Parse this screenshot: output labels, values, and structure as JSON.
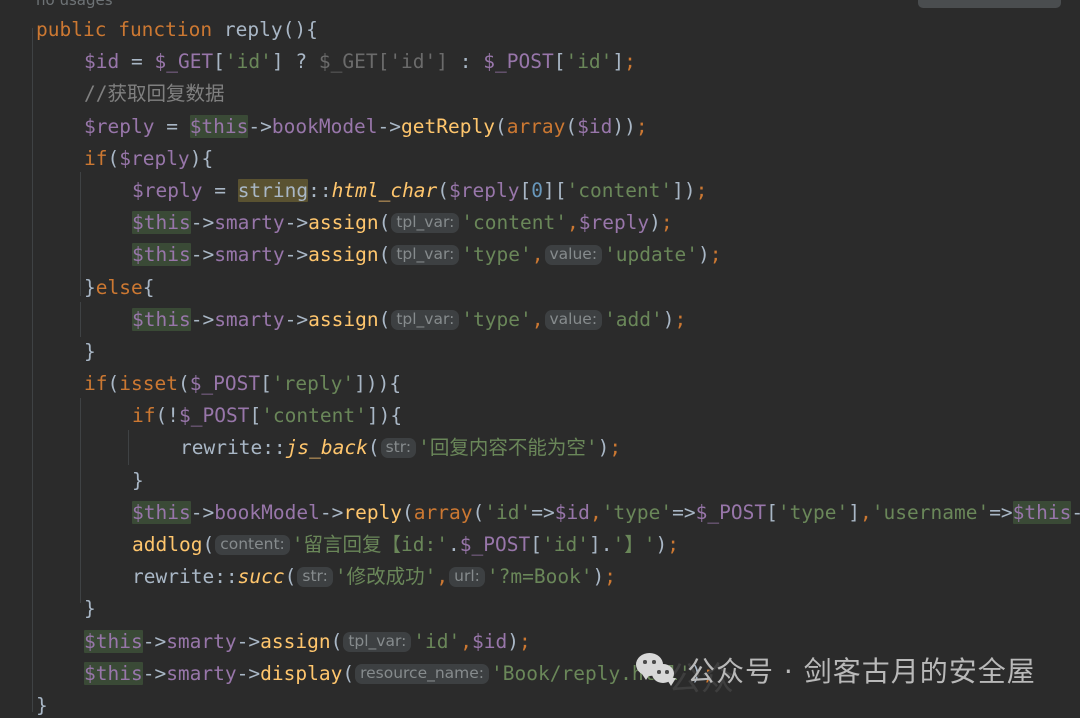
{
  "editor": {
    "language": "PHP",
    "theme": "Darcula",
    "background_color": "#2b2b2b",
    "inlay_hint_usages": "no usages",
    "colors": {
      "keyword": "#cc7832",
      "string": "#6a8759",
      "variable": "#9876aa",
      "function_call": "#ffc66d",
      "comment": "#808080",
      "default_text": "#a9b7c6",
      "dimmed_code": "#6b6b6b",
      "caret_highlight": "#3a4a36",
      "usage_highlight": "#5a5231",
      "hint_background": "#3d4042",
      "hint_text": "#868b8d"
    }
  },
  "code_lines": [
    {
      "indent": 0,
      "tokens": [
        {
          "t": "public",
          "c": "kw"
        },
        {
          "t": " ",
          "c": "op"
        },
        {
          "t": "function",
          "c": "kw"
        },
        {
          "t": " ",
          "c": "op"
        },
        {
          "t": "reply",
          "c": "fn"
        },
        {
          "t": "()",
          "c": "paren"
        },
        {
          "t": "{",
          "c": "punct"
        }
      ]
    },
    {
      "indent": 1,
      "tokens": [
        {
          "t": "$id",
          "c": "var"
        },
        {
          "t": " = ",
          "c": "op"
        },
        {
          "t": "$_GET",
          "c": "var"
        },
        {
          "t": "[",
          "c": "brkt"
        },
        {
          "t": "'id'",
          "c": "str"
        },
        {
          "t": "]",
          "c": "brkt"
        },
        {
          "t": " ? ",
          "c": "op"
        },
        {
          "t": "$_GET['id']",
          "c": "dim"
        },
        {
          "t": " : ",
          "c": "op"
        },
        {
          "t": "$_POST",
          "c": "var"
        },
        {
          "t": "[",
          "c": "brkt"
        },
        {
          "t": "'id'",
          "c": "str"
        },
        {
          "t": "]",
          "c": "brkt"
        },
        {
          "t": ";",
          "c": "semi"
        }
      ]
    },
    {
      "indent": 1,
      "tokens": [
        {
          "t": "//获取回复数据",
          "c": "comment"
        }
      ]
    },
    {
      "indent": 1,
      "tokens": [
        {
          "t": "$reply",
          "c": "var"
        },
        {
          "t": " = ",
          "c": "op"
        },
        {
          "t": "$this",
          "c": "var hl-this"
        },
        {
          "t": "->",
          "c": "op"
        },
        {
          "t": "bookModel",
          "c": "var"
        },
        {
          "t": "->",
          "c": "op"
        },
        {
          "t": "getReply",
          "c": "call"
        },
        {
          "t": "(",
          "c": "paren"
        },
        {
          "t": "array",
          "c": "kw"
        },
        {
          "t": "(",
          "c": "paren"
        },
        {
          "t": "$id",
          "c": "var"
        },
        {
          "t": "))",
          "c": "paren"
        },
        {
          "t": ";",
          "c": "semi"
        }
      ]
    },
    {
      "indent": 1,
      "tokens": [
        {
          "t": "if",
          "c": "kw"
        },
        {
          "t": "(",
          "c": "paren"
        },
        {
          "t": "$reply",
          "c": "var"
        },
        {
          "t": ")",
          "c": "paren"
        },
        {
          "t": "{",
          "c": "punct"
        }
      ]
    },
    {
      "indent": 2,
      "tokens": [
        {
          "t": "$reply",
          "c": "var"
        },
        {
          "t": " = ",
          "c": "op"
        },
        {
          "t": "string",
          "c": "cls hl-str"
        },
        {
          "t": "::",
          "c": "op"
        },
        {
          "t": "html_char",
          "c": "scall"
        },
        {
          "t": "(",
          "c": "paren"
        },
        {
          "t": "$reply",
          "c": "var"
        },
        {
          "t": "[",
          "c": "brkt"
        },
        {
          "t": "0",
          "c": "num"
        },
        {
          "t": "]",
          "c": "brkt"
        },
        {
          "t": "[",
          "c": "brkt"
        },
        {
          "t": "'content'",
          "c": "str"
        },
        {
          "t": "]",
          "c": "brkt"
        },
        {
          "t": ")",
          "c": "paren"
        },
        {
          "t": ";",
          "c": "semi"
        }
      ]
    },
    {
      "indent": 2,
      "tokens": [
        {
          "t": "$this",
          "c": "var hl-this"
        },
        {
          "t": "->",
          "c": "op"
        },
        {
          "t": "smarty",
          "c": "var"
        },
        {
          "t": "->",
          "c": "op"
        },
        {
          "t": "assign",
          "c": "call"
        },
        {
          "t": "(",
          "c": "paren"
        },
        {
          "t": "tpl_var:",
          "c": "hint"
        },
        {
          "t": "'content'",
          "c": "str"
        },
        {
          "t": ",",
          "c": "semi"
        },
        {
          "t": "$reply",
          "c": "var"
        },
        {
          "t": ")",
          "c": "paren"
        },
        {
          "t": ";",
          "c": "semi"
        }
      ]
    },
    {
      "indent": 2,
      "tokens": [
        {
          "t": "$this",
          "c": "var hl-this"
        },
        {
          "t": "->",
          "c": "op"
        },
        {
          "t": "smarty",
          "c": "var"
        },
        {
          "t": "->",
          "c": "op"
        },
        {
          "t": "assign",
          "c": "call"
        },
        {
          "t": "(",
          "c": "paren"
        },
        {
          "t": "tpl_var:",
          "c": "hint"
        },
        {
          "t": "'type'",
          "c": "str"
        },
        {
          "t": ",",
          "c": "semi"
        },
        {
          "t": "value:",
          "c": "hint"
        },
        {
          "t": "'update'",
          "c": "str"
        },
        {
          "t": ")",
          "c": "paren"
        },
        {
          "t": ";",
          "c": "semi"
        }
      ]
    },
    {
      "indent": 1,
      "tokens": [
        {
          "t": "}",
          "c": "punct"
        },
        {
          "t": "else",
          "c": "kw"
        },
        {
          "t": "{",
          "c": "punct"
        }
      ]
    },
    {
      "indent": 2,
      "tokens": [
        {
          "t": "$this",
          "c": "var hl-this"
        },
        {
          "t": "->",
          "c": "op"
        },
        {
          "t": "smarty",
          "c": "var"
        },
        {
          "t": "->",
          "c": "op"
        },
        {
          "t": "assign",
          "c": "call"
        },
        {
          "t": "(",
          "c": "paren"
        },
        {
          "t": "tpl_var:",
          "c": "hint"
        },
        {
          "t": "'type'",
          "c": "str"
        },
        {
          "t": ",",
          "c": "semi"
        },
        {
          "t": "value:",
          "c": "hint"
        },
        {
          "t": "'add'",
          "c": "str"
        },
        {
          "t": ")",
          "c": "paren"
        },
        {
          "t": ";",
          "c": "semi"
        }
      ]
    },
    {
      "indent": 1,
      "tokens": [
        {
          "t": "}",
          "c": "punct"
        }
      ]
    },
    {
      "indent": 1,
      "tokens": [
        {
          "t": "if",
          "c": "kw"
        },
        {
          "t": "(",
          "c": "paren"
        },
        {
          "t": "isset",
          "c": "kw"
        },
        {
          "t": "(",
          "c": "paren"
        },
        {
          "t": "$_POST",
          "c": "var"
        },
        {
          "t": "[",
          "c": "brkt"
        },
        {
          "t": "'reply'",
          "c": "str"
        },
        {
          "t": "]",
          "c": "brkt"
        },
        {
          "t": "))",
          "c": "paren"
        },
        {
          "t": "{",
          "c": "punct"
        }
      ]
    },
    {
      "indent": 2,
      "tokens": [
        {
          "t": "if",
          "c": "kw"
        },
        {
          "t": "(",
          "c": "paren"
        },
        {
          "t": "!",
          "c": "op"
        },
        {
          "t": "$_POST",
          "c": "var"
        },
        {
          "t": "[",
          "c": "brkt"
        },
        {
          "t": "'content'",
          "c": "str"
        },
        {
          "t": "]",
          "c": "brkt"
        },
        {
          "t": ")",
          "c": "paren"
        },
        {
          "t": "{",
          "c": "punct"
        }
      ]
    },
    {
      "indent": 3,
      "tokens": [
        {
          "t": "rewrite",
          "c": "cls"
        },
        {
          "t": "::",
          "c": "op"
        },
        {
          "t": "js_back",
          "c": "scall"
        },
        {
          "t": "(",
          "c": "paren"
        },
        {
          "t": "str:",
          "c": "hint"
        },
        {
          "t": "'回复内容不能为空'",
          "c": "str"
        },
        {
          "t": ")",
          "c": "paren"
        },
        {
          "t": ";",
          "c": "semi"
        }
      ]
    },
    {
      "indent": 2,
      "tokens": [
        {
          "t": "}",
          "c": "punct"
        }
      ]
    },
    {
      "indent": 2,
      "tokens": [
        {
          "t": "$this",
          "c": "var hl-this"
        },
        {
          "t": "->",
          "c": "op"
        },
        {
          "t": "bookModel",
          "c": "var"
        },
        {
          "t": "->",
          "c": "op"
        },
        {
          "t": "reply",
          "c": "call"
        },
        {
          "t": "(",
          "c": "paren"
        },
        {
          "t": "array",
          "c": "kw"
        },
        {
          "t": "(",
          "c": "paren"
        },
        {
          "t": "'id'",
          "c": "str"
        },
        {
          "t": "=>",
          "c": "op"
        },
        {
          "t": "$id",
          "c": "var"
        },
        {
          "t": ",",
          "c": "semi"
        },
        {
          "t": "'type'",
          "c": "str"
        },
        {
          "t": "=>",
          "c": "op"
        },
        {
          "t": "$_POST",
          "c": "var"
        },
        {
          "t": "[",
          "c": "brkt"
        },
        {
          "t": "'type'",
          "c": "str"
        },
        {
          "t": "]",
          "c": "brkt"
        },
        {
          "t": ",",
          "c": "semi"
        },
        {
          "t": "'username'",
          "c": "str"
        },
        {
          "t": "=>",
          "c": "op"
        },
        {
          "t": "$this",
          "c": "var hl-this"
        },
        {
          "t": "-",
          "c": "op"
        }
      ]
    },
    {
      "indent": 2,
      "tokens": [
        {
          "t": "addlog",
          "c": "call"
        },
        {
          "t": "(",
          "c": "paren"
        },
        {
          "t": "content:",
          "c": "hint"
        },
        {
          "t": "'留言回复【id:'",
          "c": "str"
        },
        {
          "t": ".",
          "c": "op"
        },
        {
          "t": "$_POST",
          "c": "var"
        },
        {
          "t": "[",
          "c": "brkt"
        },
        {
          "t": "'id'",
          "c": "str"
        },
        {
          "t": "]",
          "c": "brkt"
        },
        {
          "t": ".",
          "c": "op"
        },
        {
          "t": "'】'",
          "c": "str"
        },
        {
          "t": ")",
          "c": "paren"
        },
        {
          "t": ";",
          "c": "semi"
        }
      ]
    },
    {
      "indent": 2,
      "tokens": [
        {
          "t": "rewrite",
          "c": "cls"
        },
        {
          "t": "::",
          "c": "op"
        },
        {
          "t": "succ",
          "c": "scall"
        },
        {
          "t": "(",
          "c": "paren"
        },
        {
          "t": "str:",
          "c": "hint"
        },
        {
          "t": "'修改成功'",
          "c": "str"
        },
        {
          "t": ",",
          "c": "semi"
        },
        {
          "t": "url:",
          "c": "hint"
        },
        {
          "t": "'?m=Book'",
          "c": "str"
        },
        {
          "t": ")",
          "c": "paren"
        },
        {
          "t": ";",
          "c": "semi"
        }
      ]
    },
    {
      "indent": 1,
      "tokens": [
        {
          "t": "}",
          "c": "punct"
        }
      ]
    },
    {
      "indent": 1,
      "tokens": [
        {
          "t": "$this",
          "c": "var hl-this"
        },
        {
          "t": "->",
          "c": "op"
        },
        {
          "t": "smarty",
          "c": "var"
        },
        {
          "t": "->",
          "c": "op"
        },
        {
          "t": "assign",
          "c": "call"
        },
        {
          "t": "(",
          "c": "paren"
        },
        {
          "t": "tpl_var:",
          "c": "hint"
        },
        {
          "t": "'id'",
          "c": "str"
        },
        {
          "t": ",",
          "c": "semi"
        },
        {
          "t": "$id",
          "c": "var"
        },
        {
          "t": ")",
          "c": "paren"
        },
        {
          "t": ";",
          "c": "semi"
        }
      ]
    },
    {
      "indent": 1,
      "tokens": [
        {
          "t": "$this",
          "c": "var hl-this"
        },
        {
          "t": "->",
          "c": "op"
        },
        {
          "t": "smarty",
          "c": "var"
        },
        {
          "t": "->",
          "c": "op"
        },
        {
          "t": "display",
          "c": "call"
        },
        {
          "t": "(",
          "c": "paren"
        },
        {
          "t": "resource_name:",
          "c": "hint"
        },
        {
          "t": "'Book/reply.html'",
          "c": "str"
        },
        {
          "t": ")",
          "c": "paren"
        },
        {
          "t": ";",
          "c": "semi"
        }
      ]
    },
    {
      "indent": 0,
      "tokens": [
        {
          "t": "}",
          "c": "punct"
        }
      ]
    }
  ],
  "watermark": {
    "label": "公众号 · 剑客古月的安全屋",
    "icon": "wechat-logo"
  }
}
